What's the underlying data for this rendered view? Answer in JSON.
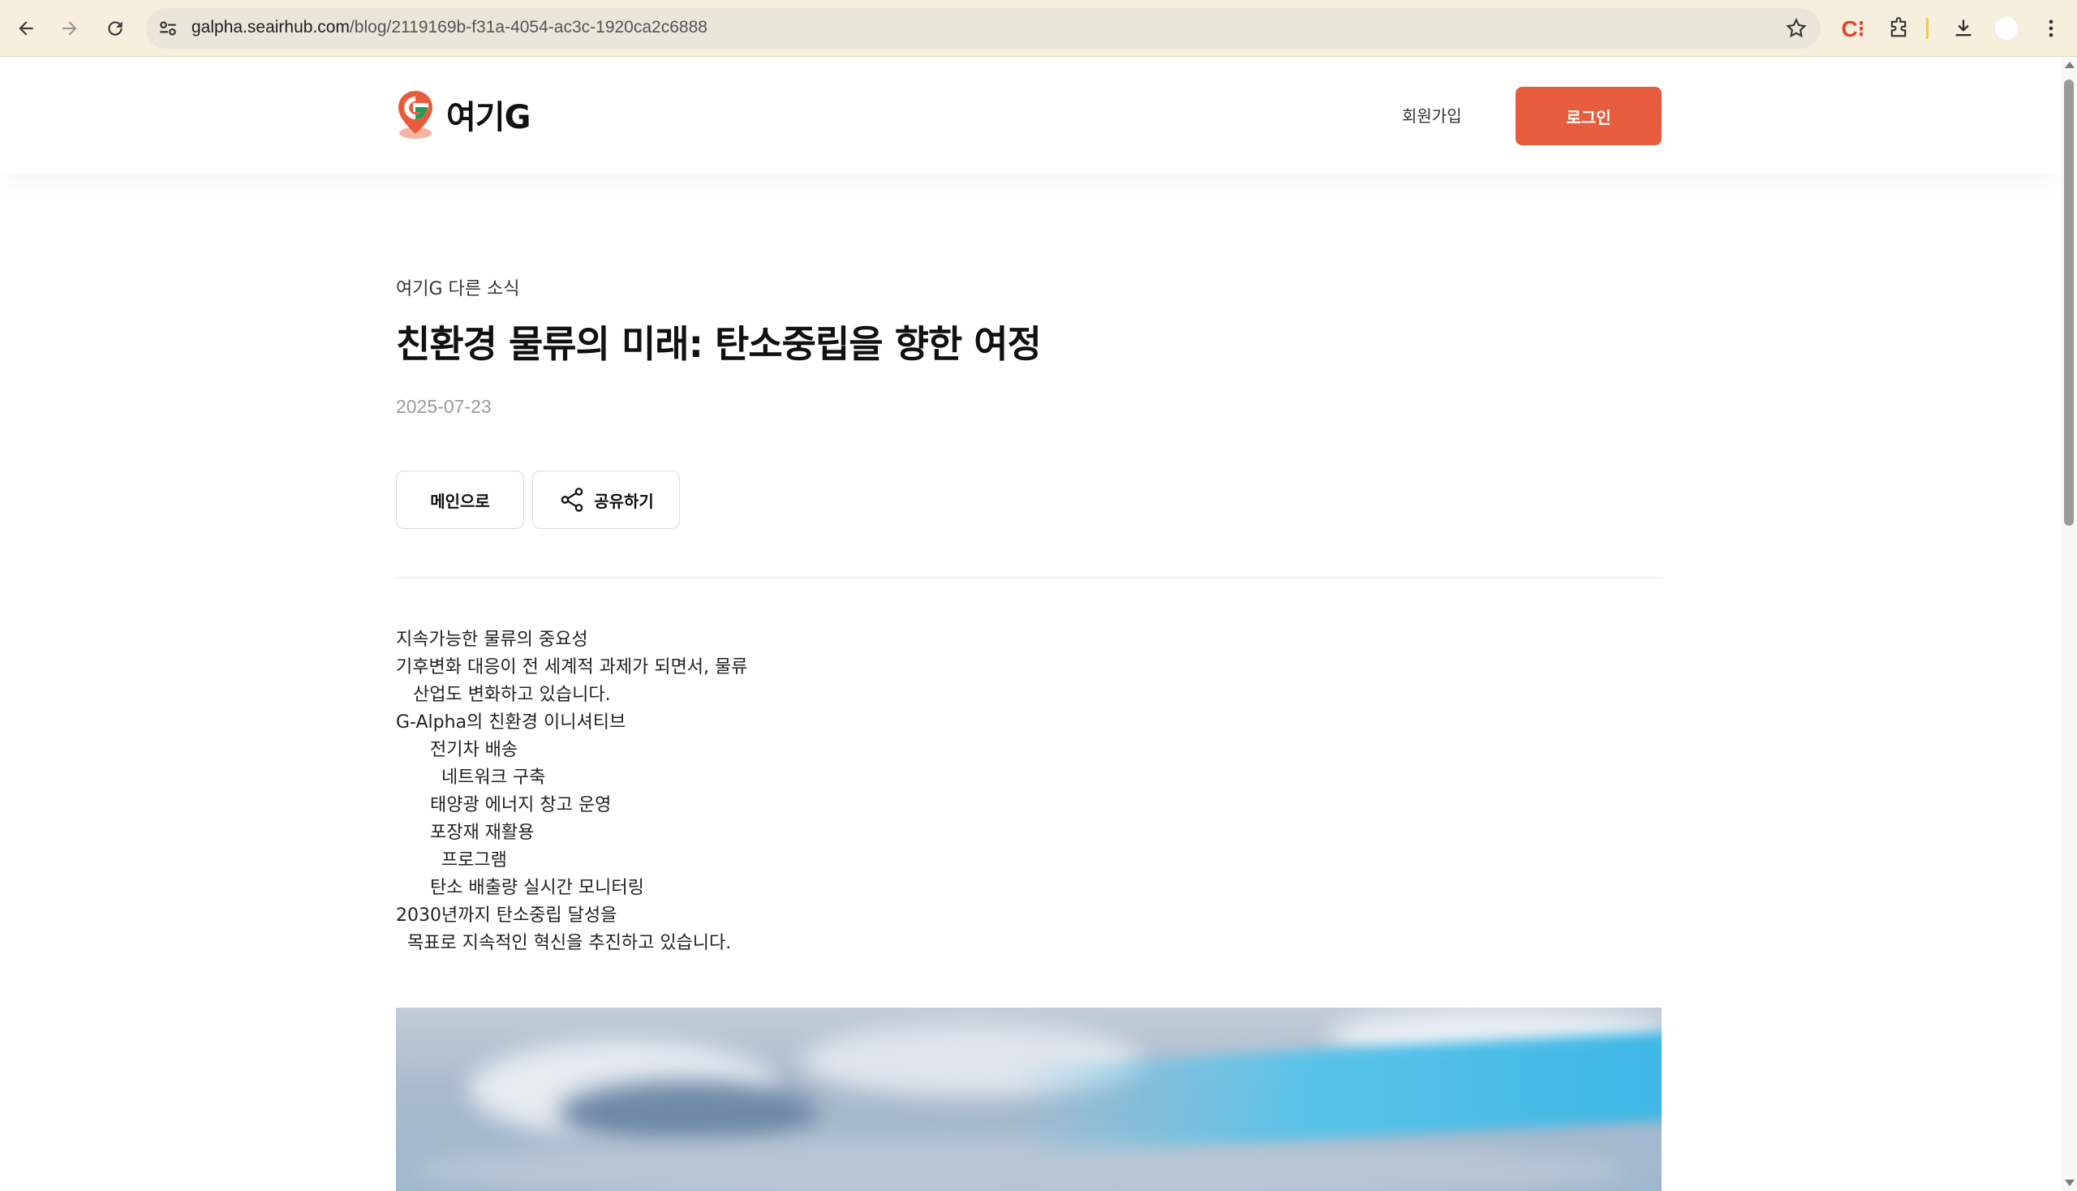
{
  "browser": {
    "url_host": "galpha.seairhub.com",
    "url_path": "/blog/2119169b-f31a-4054-ac3c-1920ca2c6888",
    "extension_label": "C⁝"
  },
  "header": {
    "logo_text": "여기G",
    "signup_label": "회원가입",
    "login_label": "로그인"
  },
  "article": {
    "category": "여기G 다른 소식",
    "title": "친환경 물류의 미래: 탄소중립을 향한 여정",
    "date": "2025-07-23",
    "main_button": "메인으로",
    "share_button": "공유하기",
    "body_lines": [
      "지속가능한 물류의 중요성",
      "기후변화 대응이 전 세계적 과제가 되면서, 물류",
      "   산업도 변화하고 있습니다.",
      "G-Alpha의 친환경 이니셔티브",
      "      전기차 배송",
      "        네트워크 구축",
      "      태양광 에너지 창고 운영",
      "      포장재 재활용",
      "        프로그램",
      "      탄소 배출량 실시간 모니터링",
      "2030년까지 탄소중립 달성을",
      "  목표로 지속적인 혁신을 추진하고 있습니다."
    ]
  },
  "colors": {
    "accent": "#e85c3e",
    "logo_green": "#1f9d57"
  }
}
